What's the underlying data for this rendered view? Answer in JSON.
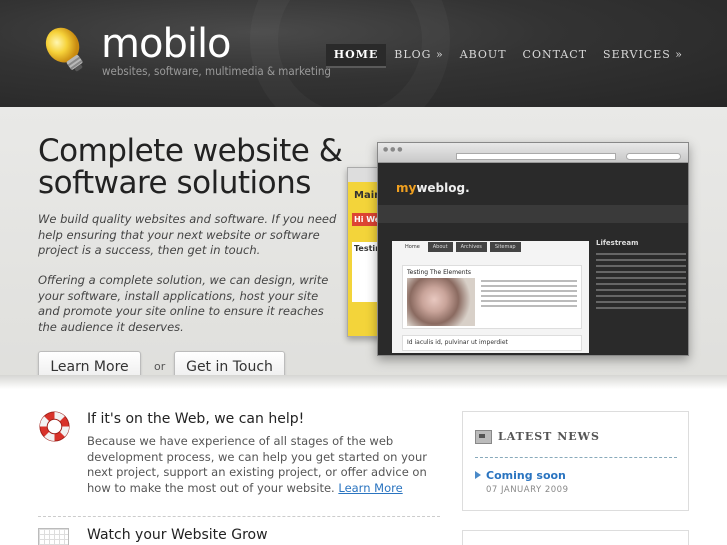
{
  "header": {
    "logo": "mobilo",
    "tagline": "websites, software, multimedia & marketing",
    "nav": [
      {
        "label": "HOME"
      },
      {
        "label": "BLOG »"
      },
      {
        "label": "ABOUT"
      },
      {
        "label": "CONTACT"
      },
      {
        "label": "SERVICES »"
      }
    ]
  },
  "hero": {
    "title": "Complete website & software solutions",
    "paragraph1": "We build quality websites and software. If you need help ensuring that your next website or software project is a success, then get in touch.",
    "paragraph2": "Offering a complete solution, we can design, write your software, install applications, host your site and promote your site online to ensure it reaches the audience it deserves.",
    "learn_more": "Learn More",
    "or": "or",
    "get_in_touch": "Get in Touch",
    "screenshot": {
      "blog_name_prefix": "my",
      "blog_name_suffix": "weblog.",
      "tabs": [
        "Home",
        "About",
        "Archives",
        "Sitemap"
      ],
      "post_title": "Testing The Elements",
      "post2_title": "Id iaculis id, pulvinar ut imperdiet",
      "sidebar_heading": "Lifestream",
      "back_title": "Main",
      "back_badge": "Hi We",
      "back_post": "Testin"
    }
  },
  "section1": {
    "title": "If it's on the Web, we can help!",
    "text": "Because we have experience of all stages of the web development process, we can help you get started on your next project, support an existing project, or offer advice on how to make the most out of your website.",
    "link": "Learn More"
  },
  "section2": {
    "title": "Watch your Website Grow"
  },
  "news": {
    "heading": "LATEST NEWS",
    "items": [
      {
        "title": "Coming soon",
        "date": "07 JANUARY 2009"
      }
    ]
  }
}
